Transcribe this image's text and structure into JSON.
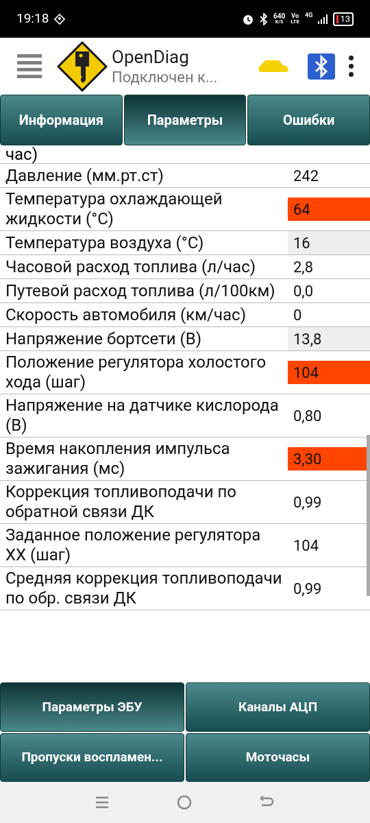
{
  "status_bar": {
    "time": "19:18",
    "speed": "640",
    "speed_unit": "K/S",
    "volte_top": "Vo",
    "volte_bottom": "LTE",
    "network": "4G",
    "battery": "13"
  },
  "app_bar": {
    "title": "OpenDiag",
    "subtitle": "Подключен к..."
  },
  "tabs": [
    {
      "label": "Информация",
      "selected": false
    },
    {
      "label": "Параметры",
      "selected": true
    },
    {
      "label": "Ошибки",
      "selected": false
    }
  ],
  "cut_row_text": "час)",
  "parameters": [
    {
      "name": "Давление (мм.рт.ст)",
      "value": "242",
      "color": "#ffffff"
    },
    {
      "name": "Температура охлаждающей жидкости (°С)",
      "value": "64",
      "color": "#ff4500"
    },
    {
      "name": "Температура воздуха (°С)",
      "value": "16",
      "color": "#eeeeee"
    },
    {
      "name": "Часовой расход топлива (л/час)",
      "value": "2,8",
      "color": "#ffffff"
    },
    {
      "name": "Путевой расход топлива (л/100км)",
      "value": "0,0",
      "color": "#ffffff"
    },
    {
      "name": "Скорость автомобиля (км/час)",
      "value": "0",
      "color": "#ffffff"
    },
    {
      "name": "Напряжение бортсети (В)",
      "value": "13,8",
      "color": "#eeeeee"
    },
    {
      "name": "Положение регулятора холостого хода (шаг)",
      "value": "104",
      "color": "#ff4500"
    },
    {
      "name": "Напряжение на датчике кислорода (В)",
      "value": "0,80",
      "color": "#ffffff"
    },
    {
      "name": "Время накопления импульса зажигания (мс)",
      "value": "3,30",
      "color": "#ff4500"
    },
    {
      "name": "Коррекция топливоподачи по обратной связи ДК",
      "value": "0,99",
      "color": "#ffffff"
    },
    {
      "name": "Заданное положение регулятора ХХ (шаг)",
      "value": "104",
      "color": "#ffffff"
    },
    {
      "name": "Средняя коррекция топливоподачи по обр. связи ДК",
      "value": "0,99",
      "color": "#ffffff"
    }
  ],
  "bottom_buttons": [
    {
      "label": "Параметры ЭБУ",
      "selected": true
    },
    {
      "label": "Каналы АЦП",
      "selected": false
    },
    {
      "label": "Пропуски воспламен...",
      "selected": false
    },
    {
      "label": "Моточасы",
      "selected": false
    }
  ]
}
